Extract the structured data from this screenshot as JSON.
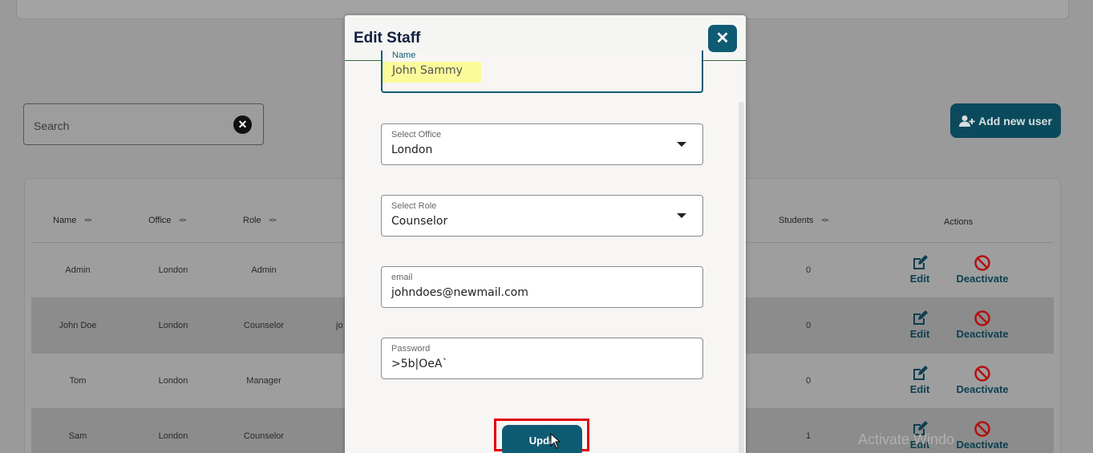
{
  "search": {
    "placeholder": "Search"
  },
  "add_user_label": "Add new user",
  "table": {
    "headers": {
      "name": "Name",
      "office": "Office",
      "role": "Role",
      "students": "Students",
      "actions": "Actions"
    },
    "rows": [
      {
        "name": "Admin",
        "office": "London",
        "role": "Admin",
        "email_fragment": "",
        "students": "0"
      },
      {
        "name": "John Doe",
        "office": "London",
        "role": "Counselor",
        "email_fragment": "jo",
        "students": "0"
      },
      {
        "name": "Tom",
        "office": "London",
        "role": "Manager",
        "email_fragment": "",
        "students": "0"
      },
      {
        "name": "Sam",
        "office": "London",
        "role": "Counselor",
        "email_fragment": "",
        "students": "1"
      }
    ],
    "edit_label": "Edit",
    "deactivate_label": "Deactivate"
  },
  "watermark": "Activate Windo",
  "modal": {
    "title": "Edit Staff",
    "close_symbol": "✕",
    "fields": {
      "name": {
        "label": "Name",
        "value": "John Sammy"
      },
      "office": {
        "label": "Select Office",
        "value": "London"
      },
      "role": {
        "label": "Select Role",
        "value": "Counselor"
      },
      "email": {
        "label": "email",
        "value": "johndoes@newmail.com"
      },
      "password": {
        "label": "Password",
        "value": ">5b|OeA`"
      }
    },
    "update_label": "Upda"
  },
  "colors": {
    "primary": "#0e5c73",
    "highlight": "#fbfb9c",
    "annotation": "#e00000"
  }
}
